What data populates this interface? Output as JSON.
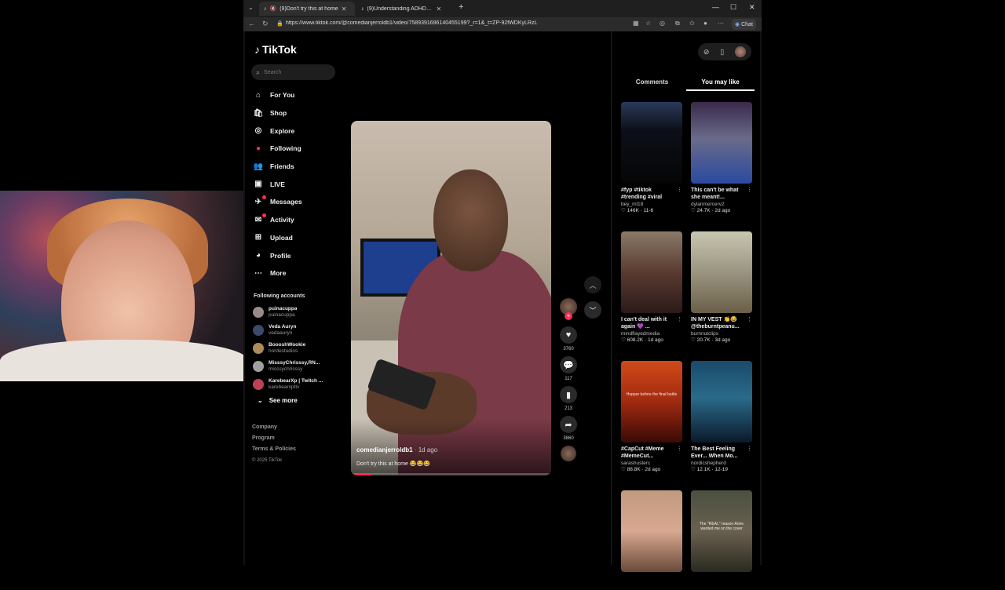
{
  "browser": {
    "tabs": [
      {
        "title": "(9)Don't try this at home",
        "active": true
      },
      {
        "title": "(9)Understanding ADHD with Hum",
        "active": false
      }
    ],
    "url": "https://www.tiktok.com/@comedianjerroldb1/video/7589391696140455199?_r=1&_t=ZP-92fWDKyLRzL",
    "chat_label": "Chat"
  },
  "tiktok": {
    "logo": "TikTok",
    "search_placeholder": "Search",
    "nav": [
      {
        "label": "For You",
        "icon": "home-icon"
      },
      {
        "label": "Shop",
        "icon": "shop-icon"
      },
      {
        "label": "Explore",
        "icon": "compass-icon"
      },
      {
        "label": "Following",
        "icon": "following-icon"
      },
      {
        "label": "Friends",
        "icon": "friends-icon"
      },
      {
        "label": "LIVE",
        "icon": "live-icon"
      },
      {
        "label": "Messages",
        "icon": "messages-icon"
      },
      {
        "label": "Activity",
        "icon": "activity-icon"
      },
      {
        "label": "Upload",
        "icon": "upload-icon"
      },
      {
        "label": "Profile",
        "icon": "profile-icon"
      },
      {
        "label": "More",
        "icon": "more-icon"
      }
    ],
    "following_header": "Following accounts",
    "accounts": [
      {
        "name": "puinacuppa",
        "username": "puinacuppa",
        "color": "#9a8a88"
      },
      {
        "name": "Veda Auryn",
        "username": "vedaauryn",
        "color": "#3a4a6a"
      },
      {
        "name": "BoooshWookie",
        "username": "hordestudios",
        "color": "#b08a5a"
      },
      {
        "name": "MisssyChrisssy,RN...",
        "username": "misssychrisssy",
        "color": "#a0a0a0"
      },
      {
        "name": "KarebearXp | Twitch ...",
        "username": "karebearxpttv",
        "color": "#c04058"
      }
    ],
    "see_more": "See more",
    "footer": [
      "Company",
      "Program",
      "Terms & Policies"
    ],
    "copyright": "© 2025 TikTok",
    "video": {
      "author": "comedianjerroldb1",
      "age": " · 1d ago",
      "caption": "Don't try this at home 😂😂😂",
      "progress": 0.1
    },
    "actions": {
      "likes": "3760",
      "comments": "117",
      "saves": "213",
      "shares": "3860"
    },
    "panel_tabs": [
      "Comments",
      "You may like"
    ],
    "cards": [
      {
        "title": "#fyp #tiktok #trending #viral",
        "author": "bey_ml18",
        "meta": "♡ 146K · 11-6",
        "thumb_text": "",
        "bg": "linear-gradient(180deg,#2a3a5a 0%,#0c0f18 35%,#050505 100%)"
      },
      {
        "title": "This can't be what she meant!...",
        "author": "dylanmercerv2",
        "meta": "♡ 24.7K · 2d ago",
        "thumb_text": "",
        "bg": "linear-gradient(180deg,#3a2a4a 0%,#6a6a8a 45%,#2a4aa0 100%)"
      },
      {
        "title": "I can't deal with it again 💜 ...",
        "author": "mindflayedmedia",
        "meta": "♡ 608.2K · 1d ago",
        "thumb_text": "",
        "bg": "linear-gradient(180deg,#8a7a6a 0%,#5a3a30 50%,#2a1a18 100%)"
      },
      {
        "title": "IN MY VEST 👏😂 @theburntpeanu...",
        "author": "burnnutclips",
        "meta": "♡ 20.7K · 3d ago",
        "thumb_text": "",
        "bg": "linear-gradient(180deg,#c8c6b0 0%,#9a9480 50%,#6a6048 100%)"
      },
      {
        "title": "#CapCut #Meme #MemeCut...",
        "author": "sarashusterc",
        "meta": "♡ 88.8K · 2d ago",
        "thumb_text": "Hopper before the final battle",
        "bg": "linear-gradient(180deg,#d04a18 0%,#a02a10 50%,#3a0a05 100%)"
      },
      {
        "title": "The Best Feeling Ever... When Mo...",
        "author": "nordicshepherd",
        "meta": "♡ 12.1K · 12-19",
        "thumb_text": "",
        "bg": "linear-gradient(180deg,#1a4a6a 0%,#2a6a8a 45%,#0a1a2a 100%)"
      },
      {
        "title": "",
        "author": "",
        "meta": "",
        "thumb_text": "",
        "bg": "linear-gradient(180deg,#c09a80 0%,#d8a890 50%,#6a4a3a 100%)"
      },
      {
        "title": "",
        "author": "",
        "meta": "",
        "thumb_text": "The \"REAL\" reason Anne wanted me on the cover",
        "bg": "linear-gradient(180deg,#4a5040 0%,#6a6050 50%,#2a2a20 100%)"
      }
    ]
  }
}
